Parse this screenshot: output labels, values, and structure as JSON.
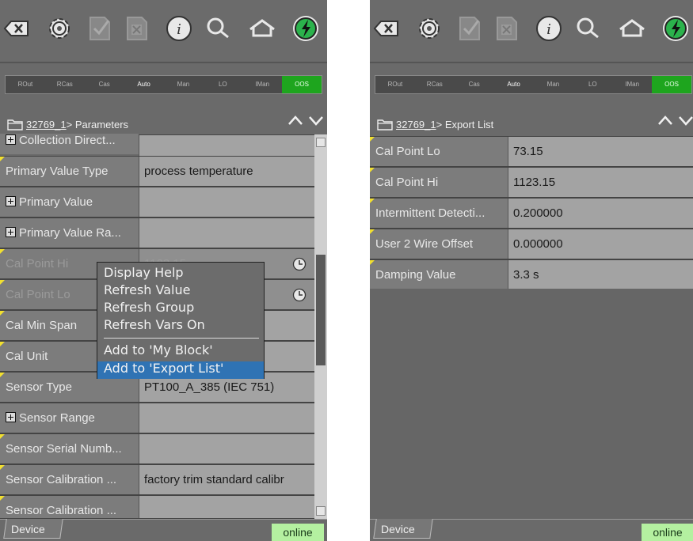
{
  "toolbar": {
    "icons": [
      "backspace-icon",
      "gear-icon",
      "checkmark-doc-icon",
      "close-doc-icon",
      "info-icon",
      "search-icon",
      "home-icon",
      "power-icon"
    ]
  },
  "modes": [
    "ROut",
    "RCas",
    "Cas",
    "Auto",
    "Man",
    "LO",
    "IMan",
    "OOS"
  ],
  "left": {
    "breadcrumb_link": "32769_1",
    "breadcrumb_rest": "> Parameters",
    "rows": [
      {
        "label": "Collection Direct...",
        "value": "",
        "expand": true
      },
      {
        "label": "Primary Value Type",
        "value": "process temperature",
        "expand": false
      },
      {
        "label": "Primary Value",
        "value": "",
        "expand": true
      },
      {
        "label": "Primary Value Ra...",
        "value": "",
        "expand": true
      },
      {
        "label": "Cal Point Hi",
        "value": "1123.15",
        "expand": false
      },
      {
        "label": "Cal Point Lo",
        "value": "",
        "expand": false
      },
      {
        "label": "Cal Min Span",
        "value": "",
        "expand": false
      },
      {
        "label": "Cal Unit",
        "value": "",
        "expand": false
      },
      {
        "label": "Sensor Type",
        "value": "PT100_A_385 (IEC 751)",
        "expand": false
      },
      {
        "label": "Sensor Range",
        "value": "",
        "expand": true
      },
      {
        "label": "Sensor Serial Numb...",
        "value": "",
        "expand": false
      },
      {
        "label": "Sensor Calibration ...",
        "value": "factory trim standard calibr",
        "expand": false
      },
      {
        "label": "Sensor Calibration ...",
        "value": "",
        "expand": false
      }
    ],
    "context_menu": [
      "Display Help",
      "Refresh Value",
      "Refresh Group",
      "Refresh Vars On",
      "Add to 'My Block'",
      "Add to 'Export List'"
    ],
    "tab_label": "Device",
    "status": "online"
  },
  "right": {
    "breadcrumb_link": "32769_1",
    "breadcrumb_rest": "> Export List",
    "rows": [
      {
        "label": "Cal Point Lo",
        "value": "73.15"
      },
      {
        "label": "Cal Point Hi",
        "value": "1123.15"
      },
      {
        "label": "Intermittent Detecti...",
        "value": "0.200000"
      },
      {
        "label": "User 2 Wire Offset",
        "value": "0.000000"
      },
      {
        "label": "Damping Value",
        "value": "3.3 s"
      }
    ],
    "tab_label": "Device",
    "status": "online"
  }
}
